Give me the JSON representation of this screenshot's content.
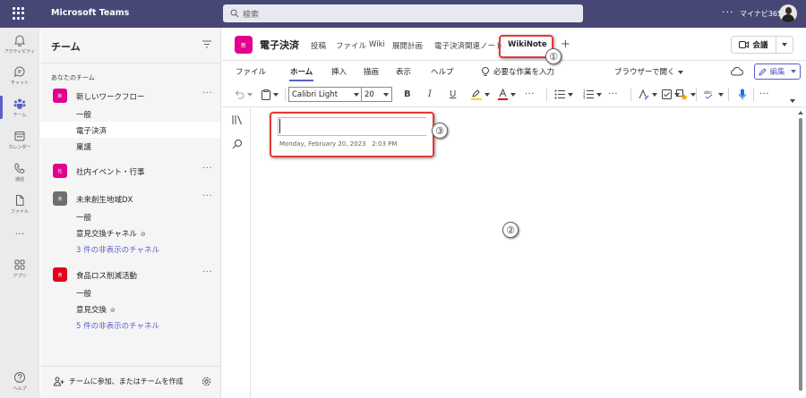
{
  "app": {
    "name": "Microsoft Teams",
    "search_placeholder": "検索",
    "more": "···",
    "user_name": "マイナビ365"
  },
  "rail": [
    {
      "label": "アクティビティ",
      "icon": "bell-icon"
    },
    {
      "label": "チャット",
      "icon": "chat-icon"
    },
    {
      "label": "チーム",
      "icon": "teams-icon",
      "active": true
    },
    {
      "label": "カレンダー",
      "icon": "calendar-icon"
    },
    {
      "label": "通話",
      "icon": "phone-icon"
    },
    {
      "label": "ファイル",
      "icon": "file-icon"
    },
    {
      "label": "···",
      "icon": "more-icon"
    },
    {
      "label": "アプリ",
      "icon": "apps-icon"
    },
    {
      "label": "ヘルプ",
      "icon": "help-icon"
    }
  ],
  "teams_panel": {
    "title": "チーム",
    "section_label": "あなたのチーム",
    "teams": [
      {
        "avatar": "新",
        "name": "新しいワークフロー",
        "color": "#e3008c",
        "more": "···",
        "channels": [
          {
            "name": "一般"
          },
          {
            "name": "電子決済"
          },
          {
            "name": "稟議"
          }
        ]
      },
      {
        "avatar": "社",
        "name": "社内イベント・行事",
        "color": "#e3008c",
        "more": "···",
        "channels": []
      },
      {
        "avatar": "未",
        "name": "未来創生地域DX",
        "color": "#6e6e6e",
        "more": "···",
        "channels": [
          {
            "name": "一般"
          },
          {
            "name": "意見交換チャネル"
          }
        ],
        "hidden": "3 件の非表示のチャネル"
      },
      {
        "avatar": "食",
        "name": "食品ロス削減活動",
        "color": "#e3001b",
        "more": "···",
        "channels": [
          {
            "name": "一般"
          },
          {
            "name": "意見交換"
          }
        ],
        "hidden": "5 件の非表示のチャネル"
      }
    ],
    "join_label": "チームに参加、またはチームを作成"
  },
  "channel_header": {
    "avatar": "新",
    "name": "電子決済",
    "tabs": [
      "投稿",
      "ファイル",
      "Wiki",
      "展開計画",
      "電子決済関連ノート",
      "WikiNote"
    ],
    "active_tab": "WikiNote",
    "add_tab": "+",
    "meet_label": "会議"
  },
  "ribbon": {
    "tabs": [
      "ファイル",
      "ホーム",
      "挿入",
      "描画",
      "表示",
      "ヘルプ"
    ],
    "active_tab": "ホーム",
    "tell_me": "必要な作業を入力",
    "browser_open": "ブラウザーで開く",
    "edit_label": "編集"
  },
  "toolbar": {
    "font_name": "Calibri Light",
    "font_size": "20",
    "bold": "B",
    "italic": "I",
    "underline": "U",
    "more": "···"
  },
  "note": {
    "date": "Monday, February 20, 2023",
    "time": "2:03 PM"
  },
  "callouts": [
    "①",
    "②",
    "③"
  ]
}
